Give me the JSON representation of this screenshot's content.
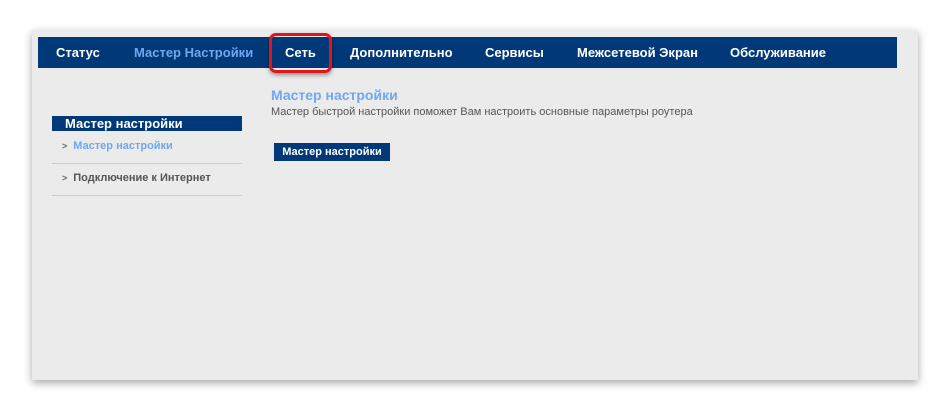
{
  "nav": {
    "items": [
      "Статус",
      "Мастер Настройки",
      "Сеть",
      "Дополнительно",
      "Сервисы",
      "Межсетевой Экран",
      "Обслуживание"
    ]
  },
  "sidebar": {
    "header": "Мастер настройки",
    "items": [
      {
        "label": "Мастер настройки"
      },
      {
        "label": "Подключение к Интернет"
      }
    ]
  },
  "main": {
    "title": "Мастер настройки",
    "description": "Мастер быстрой настройки поможет Вам настроить основные параметры роутера",
    "button": "Мастер настройки"
  },
  "colors": {
    "brand": "#003878",
    "accent": "#6fa8f0",
    "highlight": "#e0141a"
  }
}
